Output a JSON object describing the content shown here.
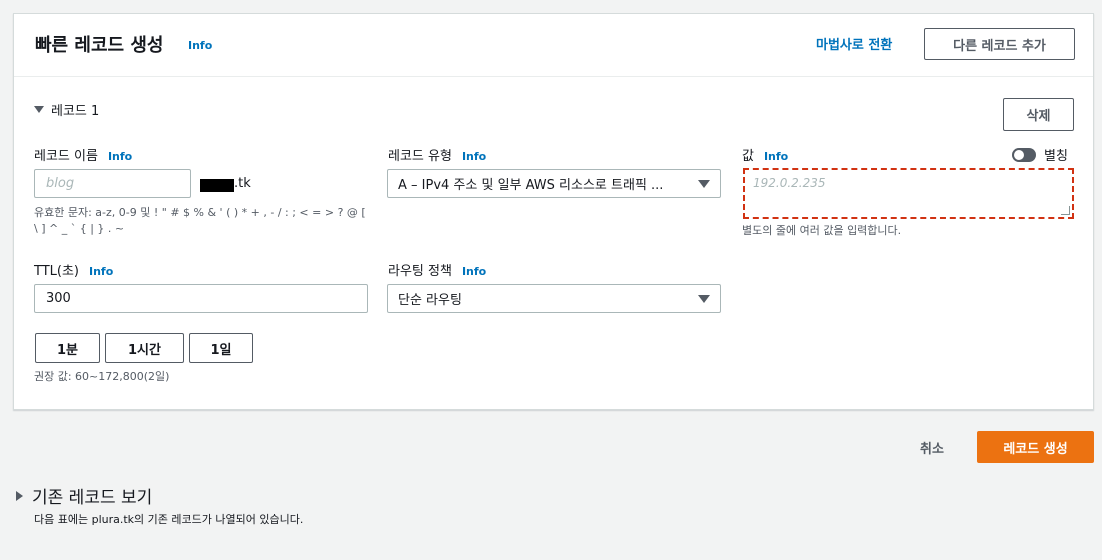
{
  "header": {
    "title": "빠른 레코드 생성",
    "info": "Info",
    "wizard_link": "마법사로 전환",
    "add_record": "다른 레코드 추가"
  },
  "record": {
    "toggle_label": "레코드 1",
    "delete": "삭제",
    "name": {
      "label": "레코드 이름",
      "info": "Info",
      "placeholder": "blog",
      "domain_suffix": ".tk",
      "helper": "유효한 문자: a-z, 0-9 및 ! \" # $ % & ' ( ) * + , - / : ; < = > ? @ [ \\ ] ^ _ ` { | } . ~"
    },
    "type": {
      "label": "레코드 유형",
      "info": "Info",
      "value": "A – IPv4 주소 및 일부 AWS 리소스로 트래픽 ..."
    },
    "value": {
      "label": "값",
      "info": "Info",
      "alias_label": "별칭",
      "placeholder": "192.0.2.235",
      "helper": "별도의 줄에 여러 값을 입력합니다."
    },
    "ttl": {
      "label": "TTL(초)",
      "info": "Info",
      "value": "300",
      "buttons": [
        "1분",
        "1시간",
        "1일"
      ],
      "helper": "권장 값: 60~172,800(2일)"
    },
    "routing": {
      "label": "라우팅 정책",
      "info": "Info",
      "value": "단순 라우팅"
    }
  },
  "footer": {
    "cancel": "취소",
    "create": "레코드 생성"
  },
  "existing": {
    "title": "기존 레코드 보기",
    "description": "다음 표에는 plura.tk의 기존 레코드가 나열되어 있습니다."
  },
  "colors": {
    "primary": "#ec7211",
    "link": "#0073bb",
    "highlight": "#d13212"
  }
}
